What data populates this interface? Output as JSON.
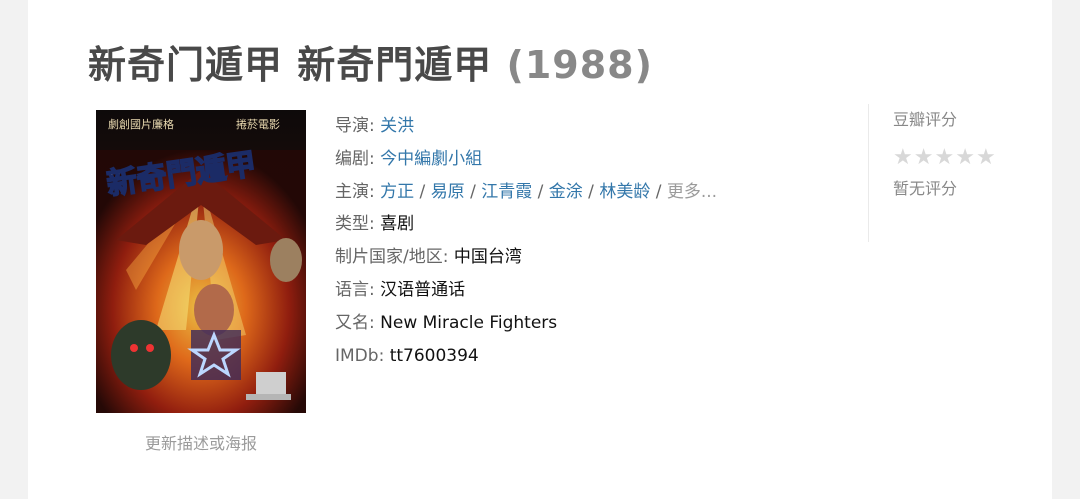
{
  "title": {
    "name": "新奇门遁甲 新奇門遁甲",
    "year": "(1988)"
  },
  "poster": {
    "top_left_text": "劇創國片廉格",
    "top_right_text": "捲菸電影",
    "title_text": "新奇門遁甲",
    "link_label": "更新描述或海报"
  },
  "info": {
    "director": {
      "label": "导演: ",
      "value": "关洪"
    },
    "writer": {
      "label": "编剧: ",
      "value": "今中編劇小組"
    },
    "cast": {
      "label": "主演: ",
      "names": [
        "方正",
        "易原",
        "江青霞",
        "金涂",
        "林美龄"
      ],
      "separator": " / ",
      "more": "更多..."
    },
    "genre": {
      "label": "类型: ",
      "value": "喜剧"
    },
    "country": {
      "label": "制片国家/地区: ",
      "value": "中国台湾"
    },
    "language": {
      "label": "语言: ",
      "value": "汉语普通话"
    },
    "aka": {
      "label": "又名: ",
      "value": "New Miracle Fighters"
    },
    "imdb": {
      "label": "IMDb: ",
      "value": "tt7600394"
    }
  },
  "rating": {
    "label": "豆瓣评分",
    "stars_filled": 0,
    "stars_total": 5,
    "no_rating_text": "暂无评分"
  },
  "colors": {
    "link": "#3377aa",
    "label": "#666666",
    "star_empty": "#d8d8d8",
    "title": "#494949"
  },
  "icons": {
    "star": "star-icon"
  }
}
